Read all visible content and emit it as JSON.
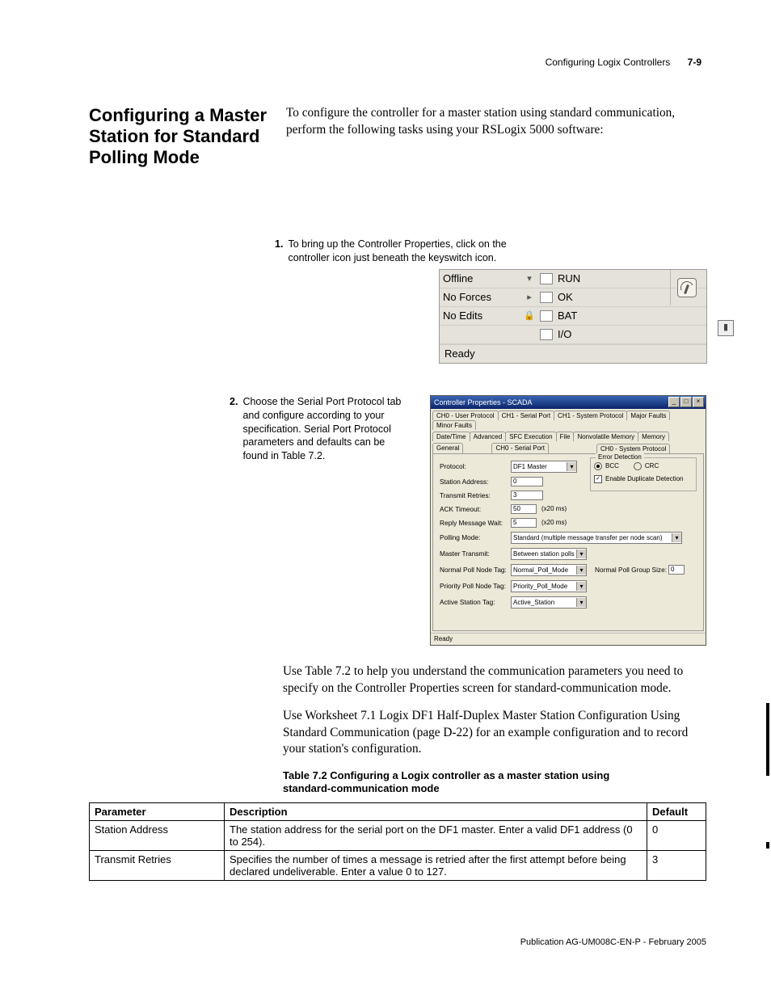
{
  "running_head": {
    "chapter": "Configuring Logix Controllers",
    "page": "7-9"
  },
  "section_heading": "Configuring a Master Station for Standard Polling Mode",
  "intro": "To configure the controller for a master station using standard communication, perform the following tasks using your RSLogix 5000 software:",
  "step1": {
    "num": "1.",
    "text": "To bring up the Controller Properties, click on the controller icon just beneath the keyswitch icon."
  },
  "statusbar": {
    "offline": "Offline",
    "forces": "No Forces",
    "edits": "No Edits",
    "run": "RUN",
    "ok": "OK",
    "bat": "BAT",
    "io": "I/O",
    "ready": "Ready"
  },
  "step2": {
    "num": "2.",
    "text": "Choose the Serial Port Protocol tab and configure according to your specification. Serial Port Protocol parameters and defaults can be found in Table 7.2."
  },
  "dialog": {
    "title": "Controller Properties - SCADA",
    "tabs_row1": [
      "CH0 - User Protocol",
      "CH1 - Serial Port",
      "CH1 - System Protocol",
      "Major Faults",
      "Minor Faults"
    ],
    "tabs_row2": [
      "Date/Time",
      "Advanced",
      "SFC Execution",
      "File",
      "Nonvolatile Memory",
      "Memory"
    ],
    "tabs_row3": [
      "General",
      "CH0 - Serial Port",
      "CH0 - System Protocol"
    ],
    "active_tab": "CH0 - System Protocol",
    "fields": {
      "protocol_label": "Protocol:",
      "protocol_value": "DF1 Master",
      "station_label": "Station Address:",
      "station_value": "0",
      "retries_label": "Transmit Retries:",
      "retries_value": "3",
      "ack_label": "ACK Timeout:",
      "ack_value": "50",
      "ack_unit": "(x20 ms)",
      "reply_label": "Reply Message Wait:",
      "reply_value": "5",
      "reply_unit": "(x20 ms)",
      "polling_label": "Polling Mode:",
      "polling_value": "Standard (multiple message transfer per node scan)",
      "master_label": "Master Transmit:",
      "master_value": "Between station polls",
      "normal_label": "Normal Poll Node Tag:",
      "normal_value": "Normal_Poll_Mode",
      "group_label": "Normal Poll Group Size:",
      "group_value": "0",
      "priority_label": "Priority Poll Node Tag:",
      "priority_value": "Priority_Poll_Mode",
      "active_label": "Active Station Tag:",
      "active_value": "Active_Station"
    },
    "error_group": {
      "legend": "Error Detection",
      "bcc": "BCC",
      "crc": "CRC",
      "dup": "Enable Duplicate Detection"
    },
    "status": "Ready"
  },
  "para1": "Use Table 7.2 to help you understand the communication parameters you need to specify on the Controller Properties screen for standard-communication mode.",
  "para2": "Use Worksheet 7.1 Logix DF1 Half-Duplex Master Station Configuration Using Standard Communication (page D-22) for an example configuration and to record your station's configuration.",
  "table": {
    "caption": "Table 7.2 Configuring a Logix controller as a master station using standard-communication mode",
    "headers": {
      "p": "Parameter",
      "d": "Description",
      "def": "Default"
    },
    "rows": [
      {
        "p": "Station Address",
        "d": "The station address for the serial port on the DF1 master. Enter a valid DF1 address (0 to 254).",
        "def": "0"
      },
      {
        "p": "Transmit Retries",
        "d": "Specifies the number of times a message is retried after the first attempt before being declared undeliverable. Enter a value 0 to 127.",
        "def": "3"
      }
    ]
  },
  "footer": "Publication AG-UM008C-EN-P - February 2005"
}
